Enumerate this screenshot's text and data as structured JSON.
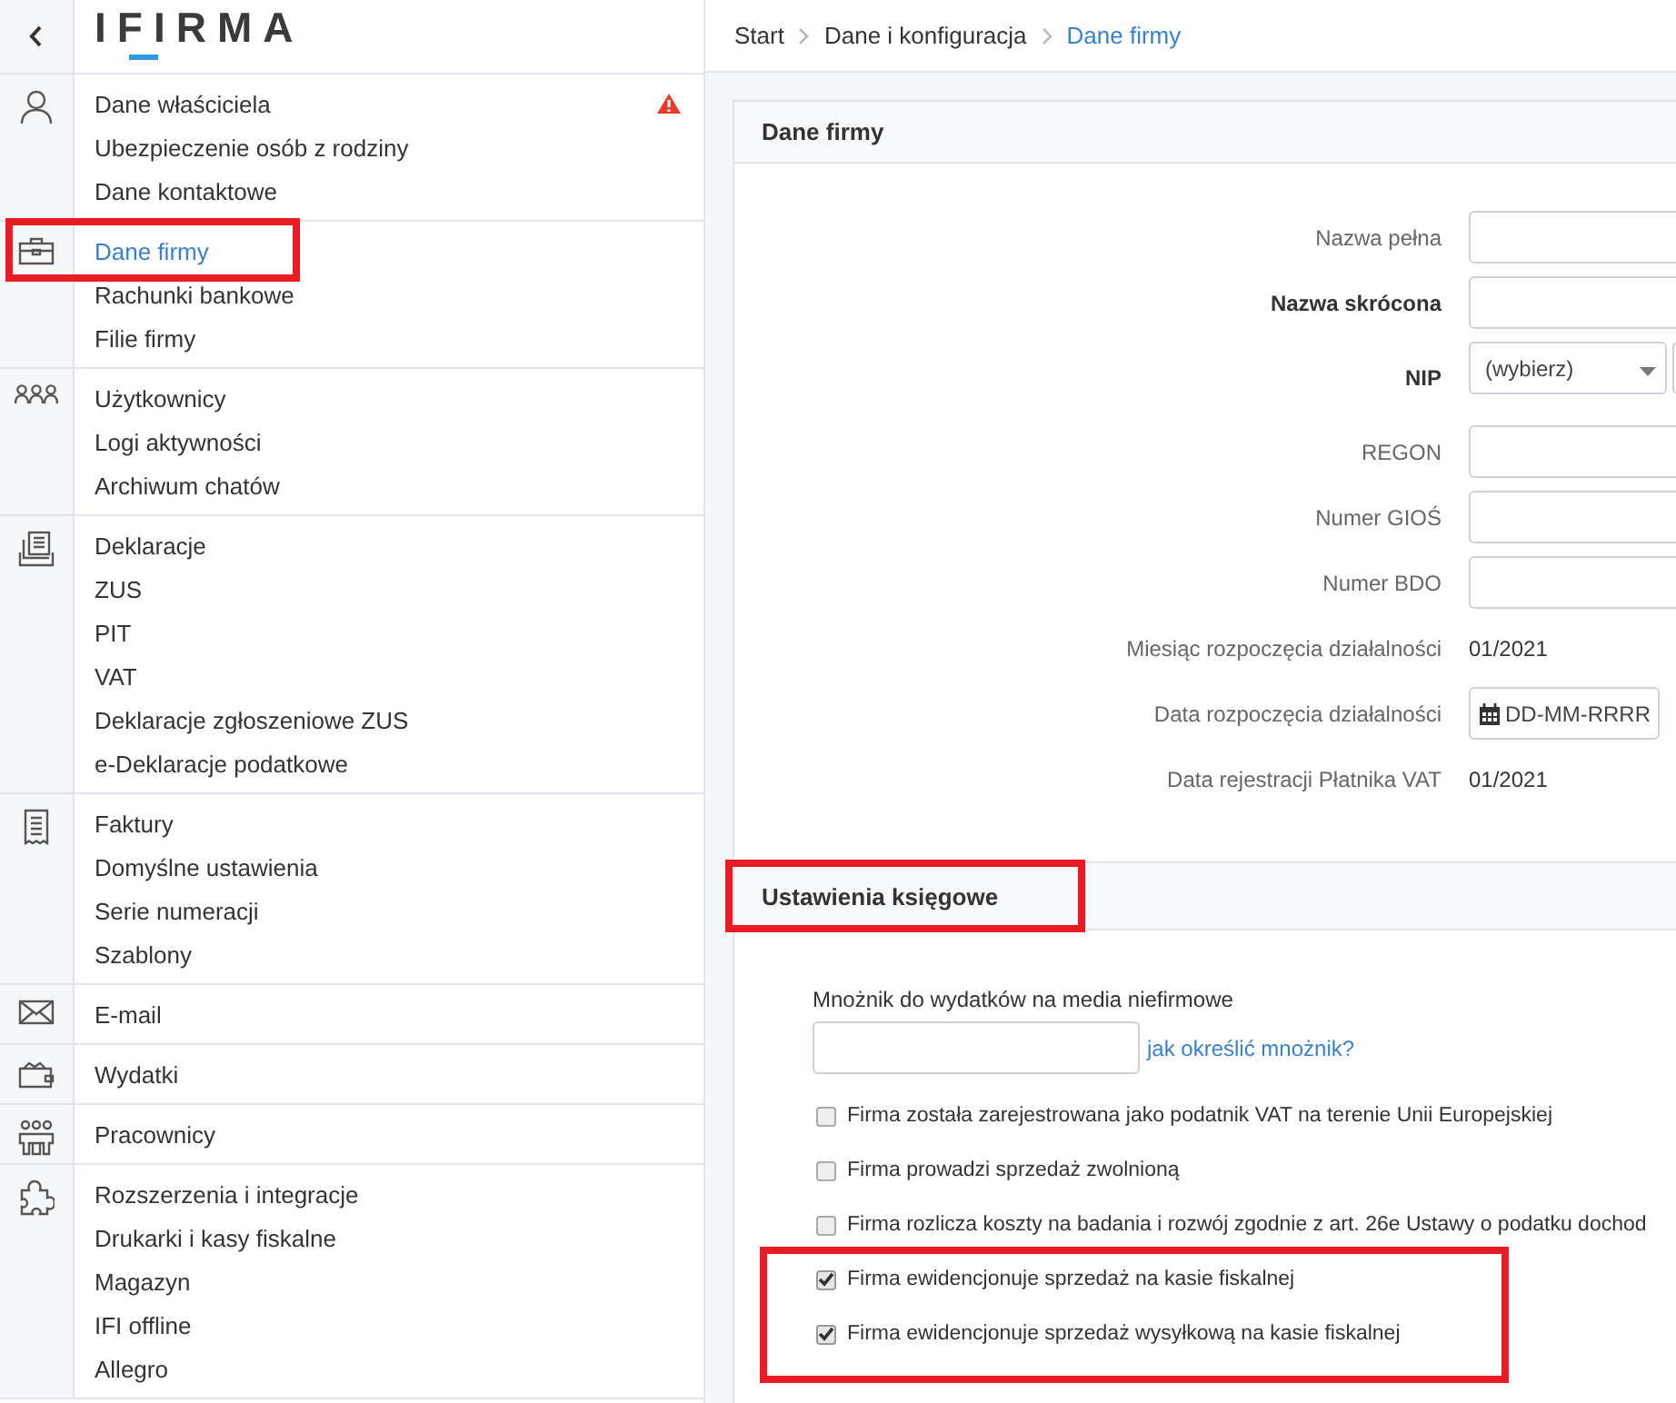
{
  "sidebar": {
    "logo": "IFIRMA",
    "groups": [
      {
        "items": [
          {
            "label": "Dane właściciela",
            "selected": false,
            "warning": true,
            "highlighted": false
          },
          {
            "label": "Ubezpieczenie osób z rodziny",
            "selected": false,
            "warning": false,
            "highlighted": false
          },
          {
            "label": "Dane kontaktowe",
            "selected": false,
            "warning": false,
            "highlighted": false
          }
        ]
      },
      {
        "items": [
          {
            "label": "Dane firmy",
            "selected": true,
            "warning": false,
            "highlighted": true
          },
          {
            "label": "Rachunki bankowe",
            "selected": false,
            "warning": false,
            "highlighted": false
          },
          {
            "label": "Filie firmy",
            "selected": false,
            "warning": false,
            "highlighted": false
          }
        ]
      },
      {
        "items": [
          {
            "label": "Użytkownicy",
            "selected": false,
            "warning": false,
            "highlighted": false
          },
          {
            "label": "Logi aktywności",
            "selected": false,
            "warning": false,
            "highlighted": false
          },
          {
            "label": "Archiwum chatów",
            "selected": false,
            "warning": false,
            "highlighted": false
          }
        ]
      },
      {
        "items": [
          {
            "label": "Deklaracje",
            "selected": false,
            "warning": false,
            "highlighted": false
          },
          {
            "label": "ZUS",
            "selected": false,
            "warning": false,
            "highlighted": false
          },
          {
            "label": "PIT",
            "selected": false,
            "warning": false,
            "highlighted": false
          },
          {
            "label": "VAT",
            "selected": false,
            "warning": false,
            "highlighted": false
          },
          {
            "label": "Deklaracje zgłoszeniowe ZUS",
            "selected": false,
            "warning": false,
            "highlighted": false
          },
          {
            "label": "e-Deklaracje podatkowe",
            "selected": false,
            "warning": false,
            "highlighted": false
          }
        ]
      },
      {
        "items": [
          {
            "label": "Faktury",
            "selected": false,
            "warning": false,
            "highlighted": false
          },
          {
            "label": "Domyślne ustawienia",
            "selected": false,
            "warning": false,
            "highlighted": false
          },
          {
            "label": "Serie numeracji",
            "selected": false,
            "warning": false,
            "highlighted": false
          },
          {
            "label": "Szablony",
            "selected": false,
            "warning": false,
            "highlighted": false
          }
        ]
      },
      {
        "items": [
          {
            "label": "E-mail",
            "selected": false,
            "warning": false,
            "highlighted": false
          }
        ]
      },
      {
        "items": [
          {
            "label": "Wydatki",
            "selected": false,
            "warning": false,
            "highlighted": false
          }
        ]
      },
      {
        "items": [
          {
            "label": "Pracownicy",
            "selected": false,
            "warning": false,
            "highlighted": false
          }
        ]
      },
      {
        "items": [
          {
            "label": "Rozszerzenia i integracje",
            "selected": false,
            "warning": false,
            "highlighted": false
          },
          {
            "label": "Drukarki i kasy fiskalne",
            "selected": false,
            "warning": false,
            "highlighted": false
          },
          {
            "label": "Magazyn",
            "selected": false,
            "warning": false,
            "highlighted": false
          },
          {
            "label": "IFI offline",
            "selected": false,
            "warning": false,
            "highlighted": false
          },
          {
            "label": "Allegro",
            "selected": false,
            "warning": false,
            "highlighted": false
          }
        ]
      }
    ]
  },
  "breadcrumb": [
    {
      "label": "Start",
      "current": false
    },
    {
      "label": "Dane i konfiguracja",
      "current": false
    },
    {
      "label": "Dane firmy",
      "current": true
    }
  ],
  "company_panel": {
    "title": "Dane firmy",
    "rows": [
      {
        "kind": "text",
        "label": "Nazwa pełna",
        "required": false
      },
      {
        "kind": "text",
        "label": "Nazwa skrócona",
        "required": true
      },
      {
        "kind": "select",
        "label": "NIP",
        "required": true,
        "value": "(wybierz)"
      },
      {
        "kind": "text",
        "label": "REGON",
        "required": false
      },
      {
        "kind": "text",
        "label": "Numer GIOŚ",
        "required": false
      },
      {
        "kind": "text",
        "label": "Numer BDO",
        "required": false
      },
      {
        "kind": "value",
        "label": "Miesiąc rozpoczęcia działalności",
        "required": false,
        "value": "01/2021"
      },
      {
        "kind": "date",
        "label": "Data rozpoczęcia działalności",
        "required": false,
        "placeholder": "DD-MM-RRRR"
      },
      {
        "kind": "value",
        "label": "Data rejestracji Płatnika VAT",
        "required": false,
        "value": "01/2021"
      }
    ]
  },
  "accounting_panel": {
    "title": "Ustawienia księgowe",
    "highlighted": true,
    "multiplier": {
      "label": "Mnożnik do wydatków na media niefirmowe",
      "link": "jak określić mnożnik?"
    },
    "options": [
      {
        "label": "Firma została zarejestrowana jako podatnik VAT na terenie Unii Europejskiej",
        "checked": false,
        "highlighted": false
      },
      {
        "label": "Firma prowadzi sprzedaż zwolnioną",
        "checked": false,
        "highlighted": false
      },
      {
        "label": "Firma rozlicza koszty na badania i rozwój zgodnie z art. 26e Ustawy o podatku dochod",
        "checked": false,
        "highlighted": false
      },
      {
        "label": "Firma ewidencjonuje sprzedaż na kasie fiskalnej",
        "checked": true,
        "highlighted": true
      },
      {
        "label": "Firma ewidencjonuje sprzedaż wysyłkową na kasie fiskalnej",
        "checked": true,
        "highlighted": true
      }
    ]
  }
}
